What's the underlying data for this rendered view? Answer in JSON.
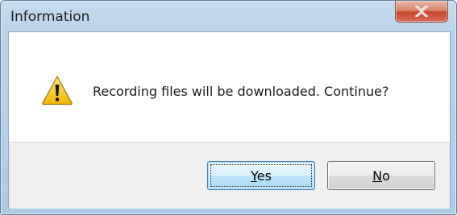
{
  "window": {
    "title": "Information"
  },
  "titlebar": {
    "close_icon": "close-x-icon"
  },
  "dialog": {
    "icon": "warning-icon",
    "message": "Recording files will be downloaded. Continue?"
  },
  "buttons": {
    "yes": {
      "mnemonic": "Y",
      "rest": "es",
      "is_default": true
    },
    "no": {
      "mnemonic": "N",
      "rest": "o",
      "is_default": false
    }
  },
  "colors": {
    "title_bar": "#b9d1e9",
    "close_button": "#c9462a",
    "warning_fill": "#f5c400",
    "default_button": "#bee6fd"
  }
}
